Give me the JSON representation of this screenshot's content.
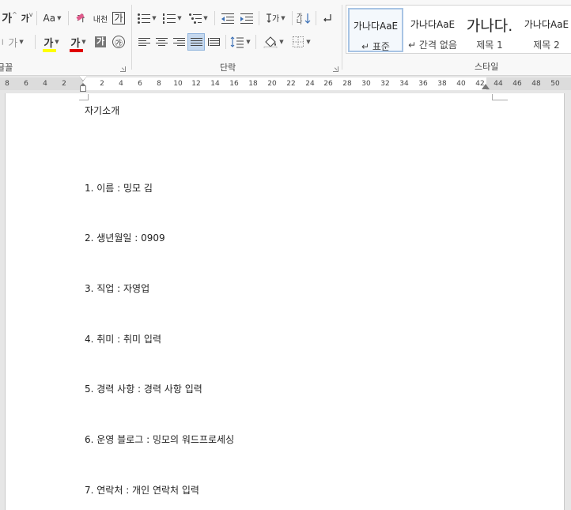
{
  "ribbon": {
    "font_group": {
      "label": "글꼴",
      "grow_font": "가",
      "shrink_font": "가",
      "change_case": "Aa",
      "clear_format": "가",
      "phonetic_guide": "내천",
      "char_border": "가",
      "char_style": "가",
      "highlight": "가",
      "font_color": "가",
      "char_shading": "가",
      "enclose_char": "㉮",
      "highlight_color": "#ffff00",
      "font_color_value": "#e00000"
    },
    "paragraph_group": {
      "label": "단락"
    },
    "styles_group": {
      "label": "스타일",
      "items": [
        {
          "sample": "가나다AaE",
          "name": "↵ 표준"
        },
        {
          "sample": "가나다AaE",
          "name": "↵ 간격 없음"
        },
        {
          "sample": "가나다.",
          "name": "제목 1"
        },
        {
          "sample": "가나다AaE",
          "name": "제목 2"
        }
      ]
    }
  },
  "ruler": {
    "labels": [
      "8",
      "6",
      "4",
      "2",
      "2",
      "4",
      "6",
      "8",
      "10",
      "12",
      "14",
      "16",
      "18",
      "20",
      "22",
      "24",
      "26",
      "28",
      "30",
      "32",
      "34",
      "36",
      "38",
      "40",
      "42",
      "44",
      "46",
      "48",
      "50"
    ]
  },
  "document": {
    "title": "자기소개",
    "lines": [
      "1. 이름 : 밍모 김",
      "2. 생년월일 : 0909",
      "3. 직업 : 자영업",
      "4. 취미 : 취미 입력",
      "5. 경력 사항 : 경력 사항 입력",
      "6. 운영 블로그 : 밍모의 워드프로세싱",
      "7. 연락처 : 개인 연락처 입력"
    ]
  },
  "colors": {
    "ribbon_bg": "#f8f8f8",
    "selected_style_border": "#a8c4e4",
    "active_button": "#c5d8ee"
  }
}
